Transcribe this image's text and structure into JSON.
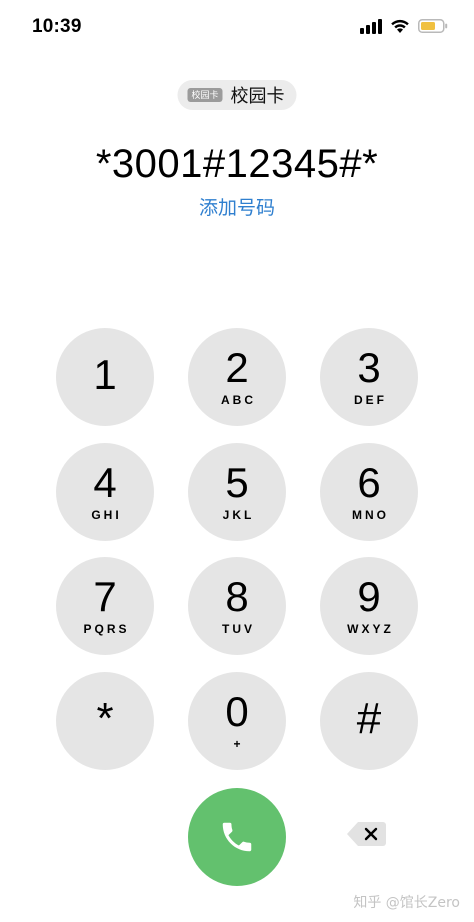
{
  "status_bar": {
    "time": "10:39",
    "icons": [
      "signal-icon",
      "wifi-icon",
      "battery-icon"
    ],
    "battery_color": "#f0c040"
  },
  "sim": {
    "badge": "校园卡",
    "name": "校园卡"
  },
  "dialer": {
    "number": "*3001#12345#*",
    "add_number_label": "添加号码"
  },
  "keypad": {
    "keys": [
      {
        "digit": "1",
        "letters": ""
      },
      {
        "digit": "2",
        "letters": "ABC"
      },
      {
        "digit": "3",
        "letters": "DEF"
      },
      {
        "digit": "4",
        "letters": "GHI"
      },
      {
        "digit": "5",
        "letters": "JKL"
      },
      {
        "digit": "6",
        "letters": "MNO"
      },
      {
        "digit": "7",
        "letters": "PQRS"
      },
      {
        "digit": "8",
        "letters": "TUV"
      },
      {
        "digit": "9",
        "letters": "WXYZ"
      },
      {
        "digit": "*",
        "letters": ""
      },
      {
        "digit": "0",
        "letters": "+"
      },
      {
        "digit": "#",
        "letters": ""
      }
    ]
  },
  "actions": {
    "call_icon": "phone-icon",
    "call_color": "#63c16e",
    "delete_icon": "delete-icon"
  },
  "watermark": "知乎 @馆长Zero"
}
